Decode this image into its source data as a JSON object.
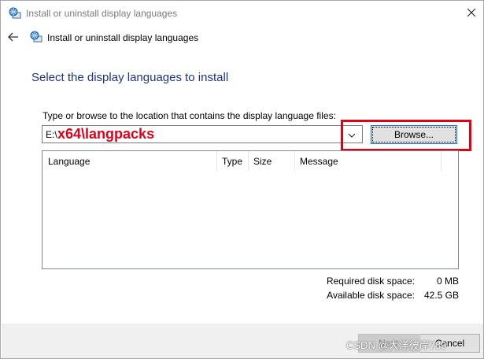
{
  "window": {
    "title": "Install or uninstall display languages"
  },
  "nav": {
    "title": "Install or uninstall display languages"
  },
  "main": {
    "heading": "Select the display languages to install",
    "path_label": "Type or browse to the location that contains the display language files:",
    "path_prefix": "E:\\",
    "path_overlay": "x64\\langpacks",
    "browse_label": "Browse...",
    "columns": [
      "Language",
      "Type",
      "Size",
      "Message"
    ]
  },
  "disk": {
    "required_label": "Required disk space:",
    "required_value": "0 MB",
    "available_label": "Available disk space:",
    "available_value": "42.5 GB"
  },
  "footer": {
    "next_label": "Next",
    "cancel_label": "Cancel"
  },
  "watermark": "CSDN @大洋彼岸789",
  "colors": {
    "heading": "#1e3287",
    "highlight": "#e00016",
    "overlay_text": "#e0001a"
  }
}
